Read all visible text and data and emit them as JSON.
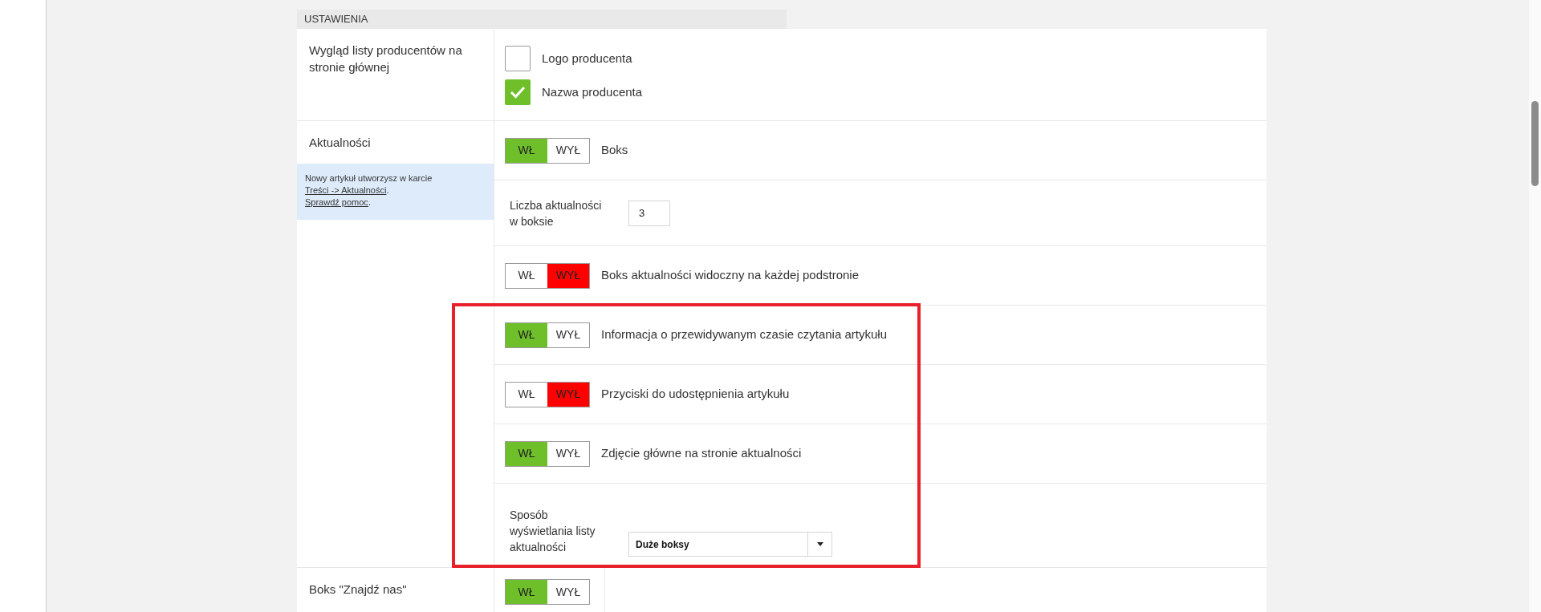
{
  "section_title": "USTAWIENIA",
  "rows": [
    {
      "label": "Wygląd listy producentów na stronie głównej",
      "settings": [
        {
          "kind": "checkboxes",
          "options": [
            {
              "label": "Logo producenta",
              "checked": false
            },
            {
              "label": "Nazwa producenta",
              "checked": true
            }
          ]
        }
      ]
    },
    {
      "label": "Aktualności",
      "help": [
        {
          "parts": [
            {
              "kind": "text",
              "text": "Nowy artykuł utworzysz w karcie "
            },
            {
              "kind": "link",
              "text": "Treści -> Aktualności"
            },
            {
              "kind": "text",
              "text": "."
            }
          ]
        },
        {
          "parts": [
            {
              "kind": "link",
              "text": "Sprawdź pomoc"
            },
            {
              "kind": "text",
              "text": "."
            }
          ]
        }
      ],
      "settings": [
        {
          "kind": "toggle",
          "on_label": "WŁ",
          "off_label": "WYŁ",
          "on": true,
          "label": "Boks",
          "highlighted": false
        },
        {
          "kind": "number",
          "label": "Liczba aktualności w boksie",
          "value": "3",
          "highlighted": false
        },
        {
          "kind": "toggle",
          "on_label": "WŁ",
          "off_label": "WYŁ",
          "on": false,
          "label": "Boks aktualności widoczny na każdej podstronie",
          "highlighted": false
        },
        {
          "kind": "toggle",
          "on_label": "WŁ",
          "off_label": "WYŁ",
          "on": true,
          "label": "Informacja o przewidywanym czasie czytania artykułu",
          "highlighted": true
        },
        {
          "kind": "toggle",
          "on_label": "WŁ",
          "off_label": "WYŁ",
          "on": false,
          "label": "Przyciski do udostępnienia artykułu",
          "highlighted": true
        },
        {
          "kind": "toggle",
          "on_label": "WŁ",
          "off_label": "WYŁ",
          "on": true,
          "label": "Zdjęcie główne na stronie aktualności",
          "highlighted": true
        },
        {
          "kind": "select",
          "label": "Sposób wyświetlania listy aktualności",
          "value": "Duże boksy",
          "highlighted": true
        }
      ]
    },
    {
      "label": "Boks \"Znajdź nas\"",
      "compact": true,
      "settings": [
        {
          "kind": "toggle",
          "on_label": "WŁ",
          "off_label": "WYŁ",
          "on": true
        }
      ]
    }
  ]
}
